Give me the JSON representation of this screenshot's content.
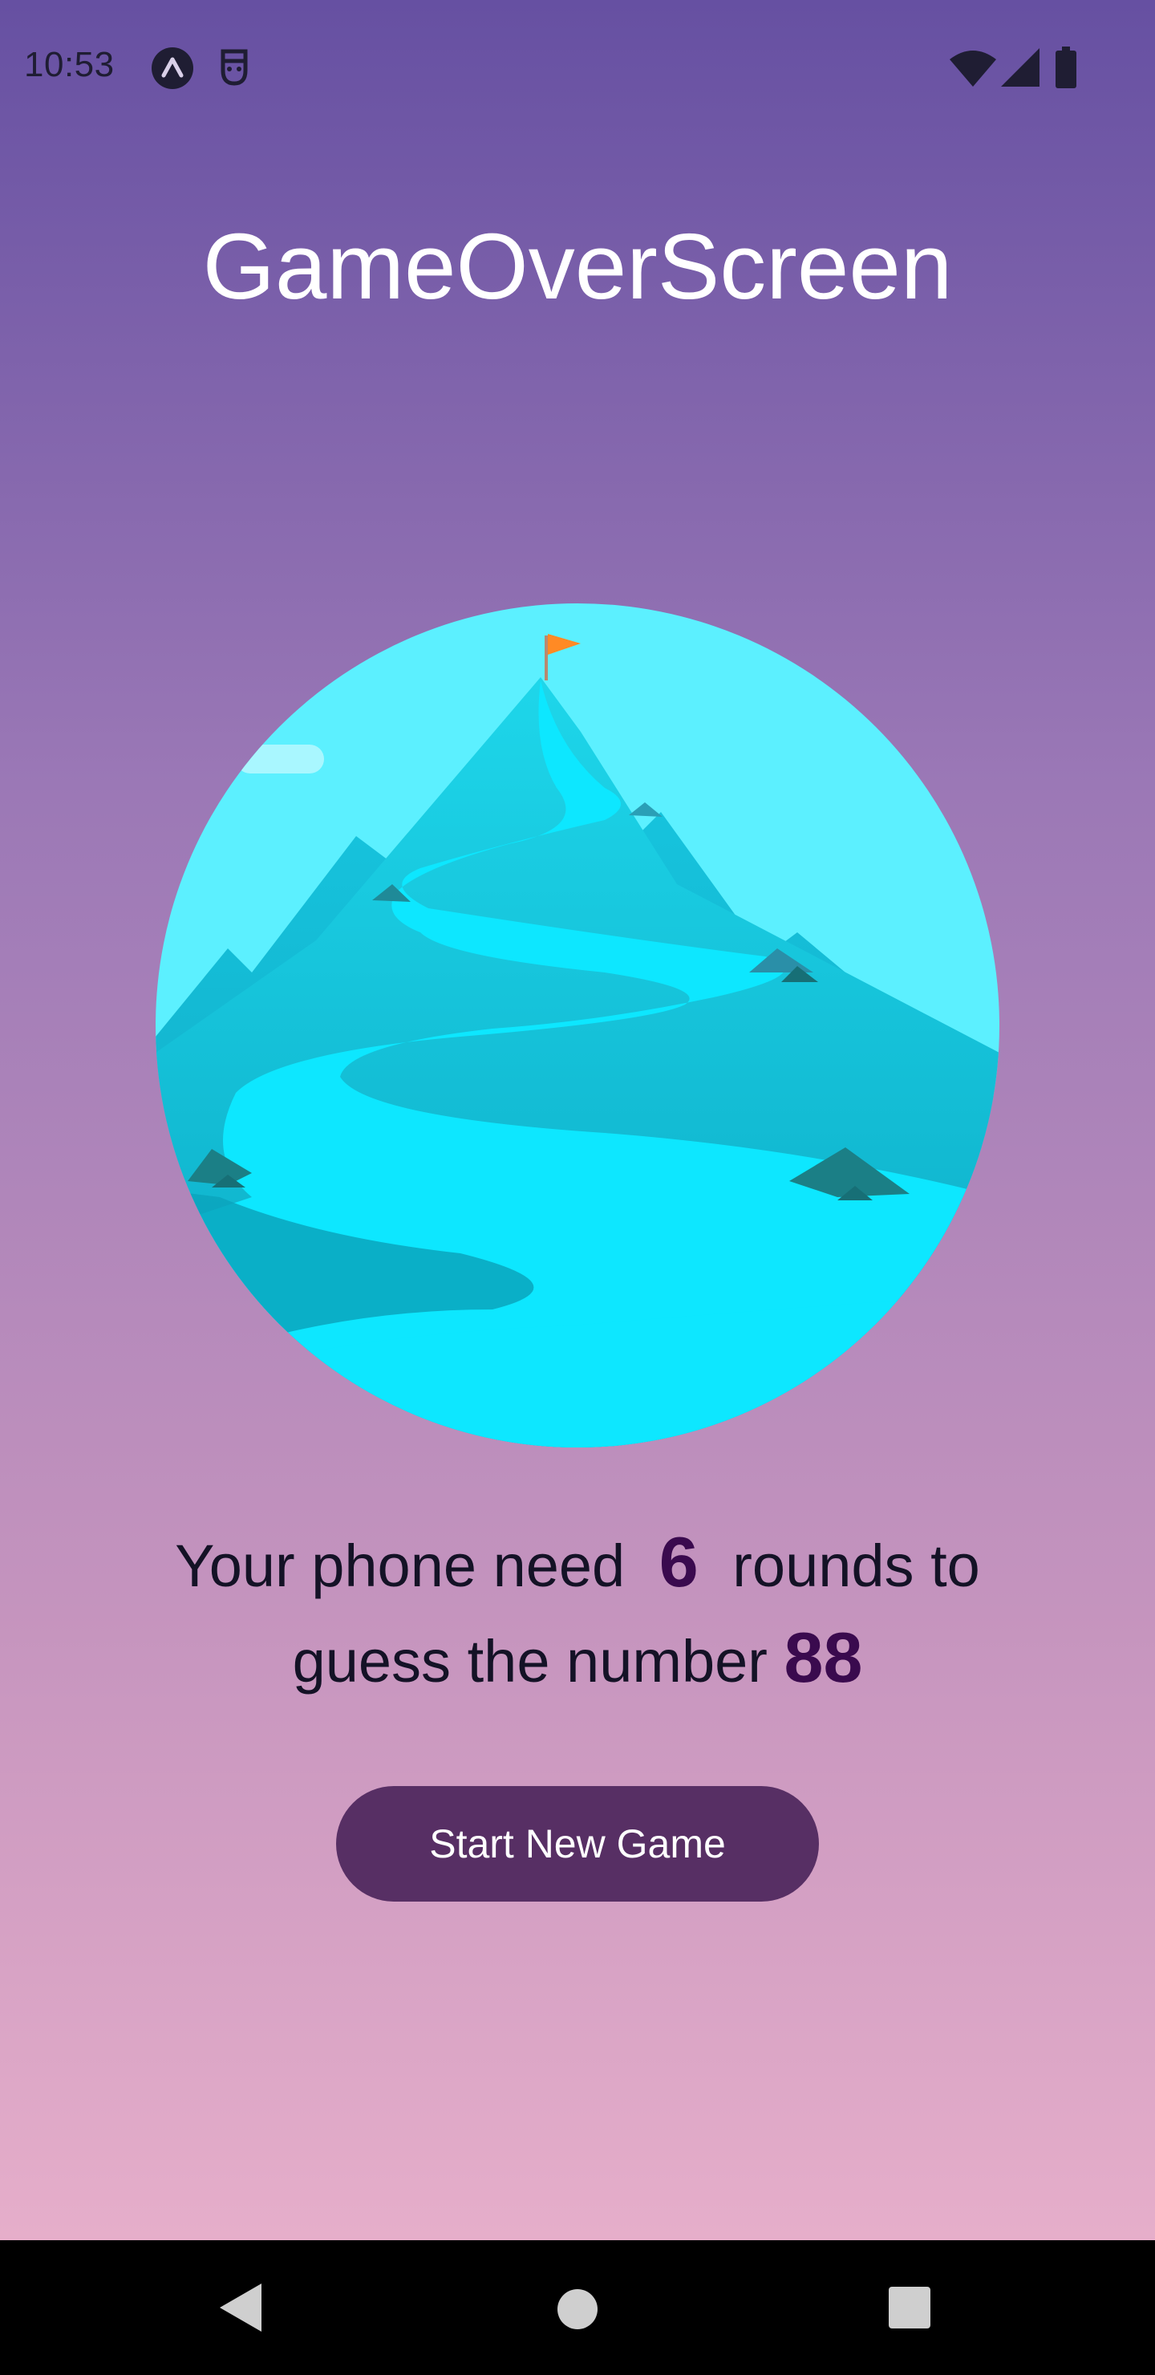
{
  "status_bar": {
    "time": "10:53",
    "icons": [
      "expo-app-icon",
      "debug-face-icon",
      "wifi-icon",
      "cellular-signal-icon",
      "battery-icon"
    ]
  },
  "screen": {
    "title": "GameOverScreen",
    "illustration_icon": "mountain-summit-illustration",
    "summary": {
      "part1": "Your phone need",
      "rounds": "6",
      "part2": "rounds to guess the number",
      "number": "88"
    },
    "start_button_label": "Start New Game"
  },
  "nav_bar": {
    "icons": [
      "back-icon",
      "home-icon",
      "recents-icon"
    ]
  },
  "colors": {
    "gradient_top": "#6650a2",
    "gradient_bottom": "#e6aeca",
    "button": "#572f64",
    "highlight": "#3a0a4e"
  }
}
